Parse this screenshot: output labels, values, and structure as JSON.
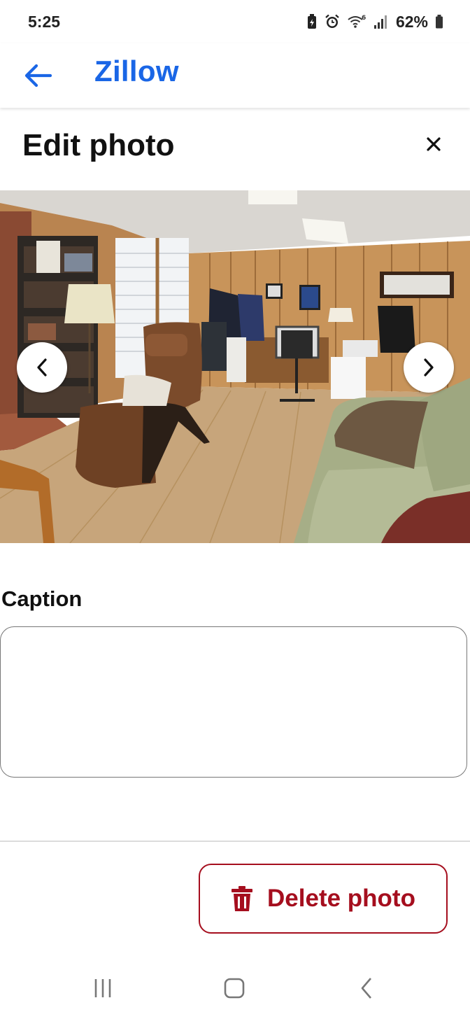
{
  "status_bar": {
    "time": "5:25",
    "battery_percent": "62%",
    "icons": [
      "battery-saver-icon",
      "alarm-icon",
      "wifi-6-icon",
      "signal-icon",
      "battery-icon"
    ]
  },
  "app_bar": {
    "title": "Zillow",
    "back_icon": "arrow-left-icon",
    "accent_color": "#1a66e6"
  },
  "header": {
    "title": "Edit photo",
    "close_icon": "close-icon"
  },
  "photo": {
    "prev_icon": "chevron-left-icon",
    "next_icon": "chevron-right-icon"
  },
  "caption": {
    "label": "Caption",
    "value": "",
    "placeholder": ""
  },
  "actions": {
    "delete_label": "Delete photo",
    "delete_icon": "trash-icon",
    "danger_color": "#a50e1e"
  },
  "system_nav": {
    "icons": [
      "recent-apps-icon",
      "home-icon",
      "back-icon"
    ]
  }
}
